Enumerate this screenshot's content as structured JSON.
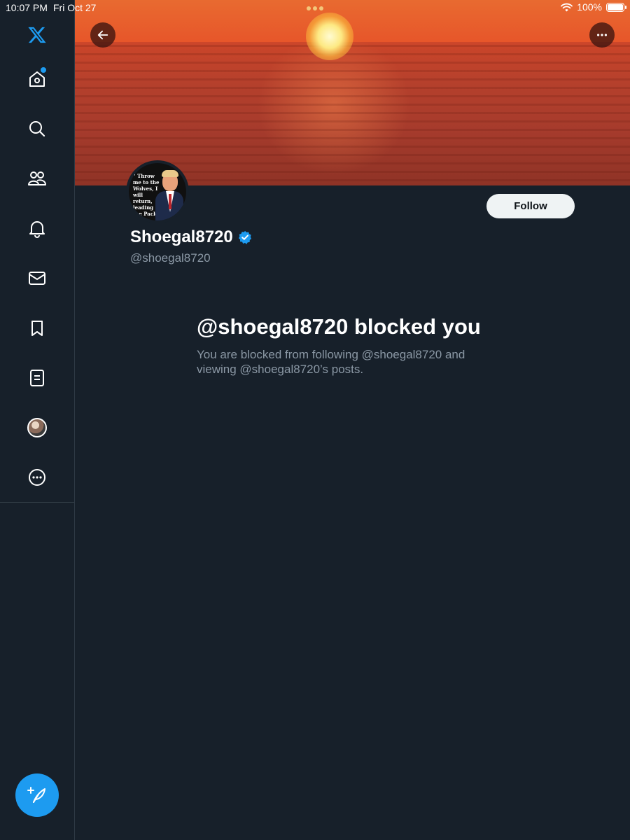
{
  "status_bar": {
    "time": "10:07 PM",
    "date": "Fri Oct 27",
    "battery": "100%"
  },
  "sidebar": {
    "items": [
      {
        "name": "logo",
        "icon": "x-logo-icon"
      },
      {
        "name": "home",
        "icon": "home-icon",
        "has_notification": true
      },
      {
        "name": "search",
        "icon": "search-icon"
      },
      {
        "name": "communities",
        "icon": "communities-icon"
      },
      {
        "name": "notifications",
        "icon": "bell-icon"
      },
      {
        "name": "messages",
        "icon": "mail-icon"
      },
      {
        "name": "bookmarks",
        "icon": "bookmark-icon"
      },
      {
        "name": "lists",
        "icon": "list-icon"
      },
      {
        "name": "profile",
        "icon": "avatar"
      },
      {
        "name": "more",
        "icon": "more-circle-icon"
      }
    ],
    "compose_icon": "compose-icon"
  },
  "profile": {
    "display_name": "Shoegal8720",
    "handle": "@shoegal8720",
    "verified": true,
    "follow_label": "Follow",
    "avatar_quote": "\" Throw me to the Wolves, I will return, leading the Pack \""
  },
  "blocked": {
    "title": "@shoegal8720 blocked you",
    "description": "You are blocked from following @shoegal8720 and viewing @shoegal8720’s posts."
  },
  "colors": {
    "background": "#17202a",
    "accent": "#1d9bf0",
    "muted_text": "#8b98a5",
    "follow_button_bg": "#eff3f4"
  }
}
